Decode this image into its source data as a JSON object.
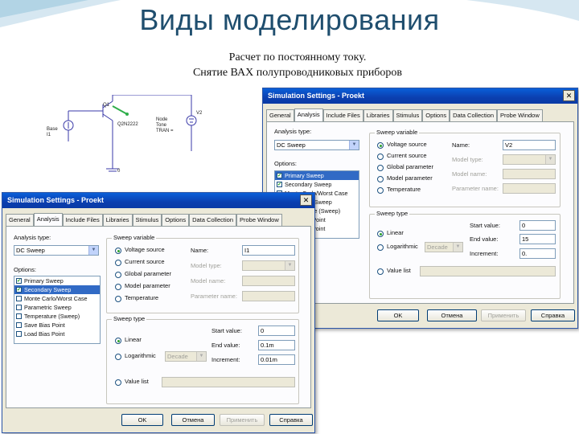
{
  "slide": {
    "title": "Виды моделирования",
    "subtitle_line1": "Расчет по постоянному току.",
    "subtitle_line2": "Снятие ВАХ полупроводниковых приборов"
  },
  "schematic": {
    "labels": {
      "q1": "Q1",
      "q2n": "Q2N2222",
      "ibase": "Base\nI1",
      "node": "Node\nTone\nTRAN =",
      "v2": "V2",
      "zero": "0"
    }
  },
  "dialog_back": {
    "title": "Simulation Settings - Proekt",
    "close_label": "✕",
    "tabs": [
      "General",
      "Analysis",
      "Include Files",
      "Libraries",
      "Stimulus",
      "Options",
      "Data Collection",
      "Probe Window"
    ],
    "analysis_type_label": "Analysis type:",
    "analysis_type_value": "DC Sweep",
    "options_label": "Options:",
    "options": [
      {
        "label": "Primary Sweep",
        "checked": true,
        "selected": true
      },
      {
        "label": "Secondary Sweep",
        "checked": true,
        "selected": false
      },
      {
        "label": "Monte Carlo/Worst Case",
        "checked": false,
        "selected": false
      },
      {
        "label": "Parametric Sweep",
        "checked": false,
        "selected": false
      },
      {
        "label": "Temperature (Sweep)",
        "checked": false,
        "selected": false
      },
      {
        "label": "Save Bias Point",
        "checked": false,
        "selected": false
      },
      {
        "label": "Load Bias Point",
        "checked": false,
        "selected": false
      }
    ],
    "sweep_variable": {
      "title": "Sweep variable",
      "items": [
        {
          "label": "Voltage source",
          "on": true
        },
        {
          "label": "Current source",
          "on": false
        },
        {
          "label": "Global parameter",
          "on": false
        },
        {
          "label": "Model parameter",
          "on": false
        },
        {
          "label": "Temperature",
          "on": false
        }
      ],
      "name_label": "Name:",
      "name_value": "V2",
      "model_type_label": "Model type:",
      "model_name_label": "Model name:",
      "param_name_label": "Parameter name:"
    },
    "sweep_type": {
      "title": "Sweep type",
      "linear_label": "Linear",
      "log_label": "Logarithmic",
      "log_select": "Decade",
      "start_label": "Start value:",
      "start_value": "0",
      "end_label": "End value:",
      "end_value": "15",
      "inc_label": "Increment:",
      "inc_value": "0.",
      "valuelist_label": "Value list"
    },
    "buttons": {
      "ok": "OK",
      "cancel": "Отмена",
      "apply": "Применить",
      "help": "Справка"
    }
  },
  "dialog_front": {
    "title": "Simulation Settings - Proekt",
    "close_label": "✕",
    "tabs": [
      "General",
      "Analysis",
      "Include Files",
      "Libraries",
      "Stimulus",
      "Options",
      "Data Collection",
      "Probe Window"
    ],
    "analysis_type_label": "Analysis type:",
    "analysis_type_value": "DC Sweep",
    "options_label": "Options:",
    "options": [
      {
        "label": "Primary Sweep",
        "checked": true,
        "selected": false
      },
      {
        "label": "Secondary Sweep",
        "checked": true,
        "selected": true
      },
      {
        "label": "Monte Carlo/Worst Case",
        "checked": false,
        "selected": false
      },
      {
        "label": "Parametric Sweep",
        "checked": false,
        "selected": false
      },
      {
        "label": "Temperature (Sweep)",
        "checked": false,
        "selected": false
      },
      {
        "label": "Save Bias Point",
        "checked": false,
        "selected": false
      },
      {
        "label": "Load Bias Point",
        "checked": false,
        "selected": false
      }
    ],
    "sweep_variable": {
      "title": "Sweep variable",
      "items": [
        {
          "label": "Voltage source",
          "on": true
        },
        {
          "label": "Current source",
          "on": false
        },
        {
          "label": "Global parameter",
          "on": false
        },
        {
          "label": "Model parameter",
          "on": false
        },
        {
          "label": "Temperature",
          "on": false
        }
      ],
      "name_label": "Name:",
      "name_value": "I1",
      "model_type_label": "Model type:",
      "model_name_label": "Model name:",
      "param_name_label": "Parameter name:"
    },
    "sweep_type": {
      "title": "Sweep type",
      "linear_label": "Linear",
      "log_label": "Logarithmic",
      "log_select": "Decade",
      "start_label": "Start value:",
      "start_value": "0",
      "end_label": "End value:",
      "end_value": "0.1m",
      "inc_label": "Increment:",
      "inc_value": "0.01m",
      "valuelist_label": "Value list"
    },
    "buttons": {
      "ok": "OK",
      "cancel": "Отмена",
      "apply": "Применить",
      "help": "Справка"
    }
  }
}
